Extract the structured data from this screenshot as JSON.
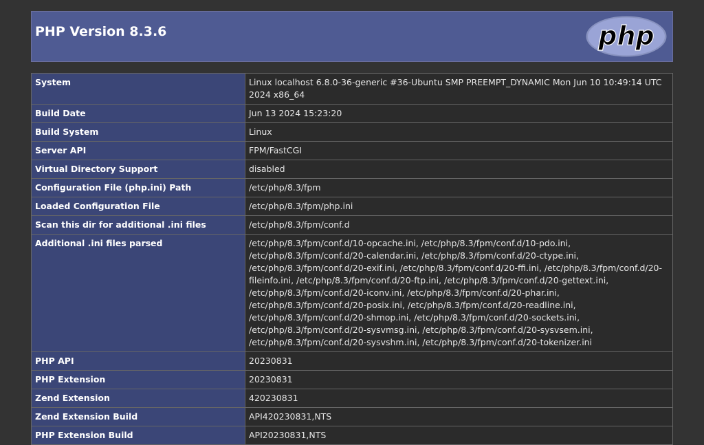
{
  "header": {
    "title": "PHP Version 8.3.6",
    "logo_text": "php"
  },
  "colors": {
    "header_bg": "#4f5b93",
    "label_bg": "#3b4677",
    "value_bg": "#2b2b2b",
    "page_bg": "#333333"
  },
  "rows": [
    {
      "label": "System",
      "value": "Linux localhost 6.8.0-36-generic #36-Ubuntu SMP PREEMPT_DYNAMIC Mon Jun 10 10:49:14 UTC 2024 x86_64"
    },
    {
      "label": "Build Date",
      "value": "Jun 13 2024 15:23:20"
    },
    {
      "label": "Build System",
      "value": "Linux"
    },
    {
      "label": "Server API",
      "value": "FPM/FastCGI"
    },
    {
      "label": "Virtual Directory Support",
      "value": "disabled"
    },
    {
      "label": "Configuration File (php.ini) Path",
      "value": "/etc/php/8.3/fpm"
    },
    {
      "label": "Loaded Configuration File",
      "value": "/etc/php/8.3/fpm/php.ini"
    },
    {
      "label": "Scan this dir for additional .ini files",
      "value": "/etc/php/8.3/fpm/conf.d"
    },
    {
      "label": "Additional .ini files parsed",
      "value": "/etc/php/8.3/fpm/conf.d/10-opcache.ini, /etc/php/8.3/fpm/conf.d/10-pdo.ini, /etc/php/8.3/fpm/conf.d/20-calendar.ini, /etc/php/8.3/fpm/conf.d/20-ctype.ini, /etc/php/8.3/fpm/conf.d/20-exif.ini, /etc/php/8.3/fpm/conf.d/20-ffi.ini, /etc/php/8.3/fpm/conf.d/20-fileinfo.ini, /etc/php/8.3/fpm/conf.d/20-ftp.ini, /etc/php/8.3/fpm/conf.d/20-gettext.ini, /etc/php/8.3/fpm/conf.d/20-iconv.ini, /etc/php/8.3/fpm/conf.d/20-phar.ini, /etc/php/8.3/fpm/conf.d/20-posix.ini, /etc/php/8.3/fpm/conf.d/20-readline.ini, /etc/php/8.3/fpm/conf.d/20-shmop.ini, /etc/php/8.3/fpm/conf.d/20-sockets.ini, /etc/php/8.3/fpm/conf.d/20-sysvmsg.ini, /etc/php/8.3/fpm/conf.d/20-sysvsem.ini, /etc/php/8.3/fpm/conf.d/20-sysvshm.ini, /etc/php/8.3/fpm/conf.d/20-tokenizer.ini"
    },
    {
      "label": "PHP API",
      "value": "20230831"
    },
    {
      "label": "PHP Extension",
      "value": "20230831"
    },
    {
      "label": "Zend Extension",
      "value": "420230831"
    },
    {
      "label": "Zend Extension Build",
      "value": "API420230831,NTS"
    },
    {
      "label": "PHP Extension Build",
      "value": "API20230831,NTS"
    }
  ]
}
